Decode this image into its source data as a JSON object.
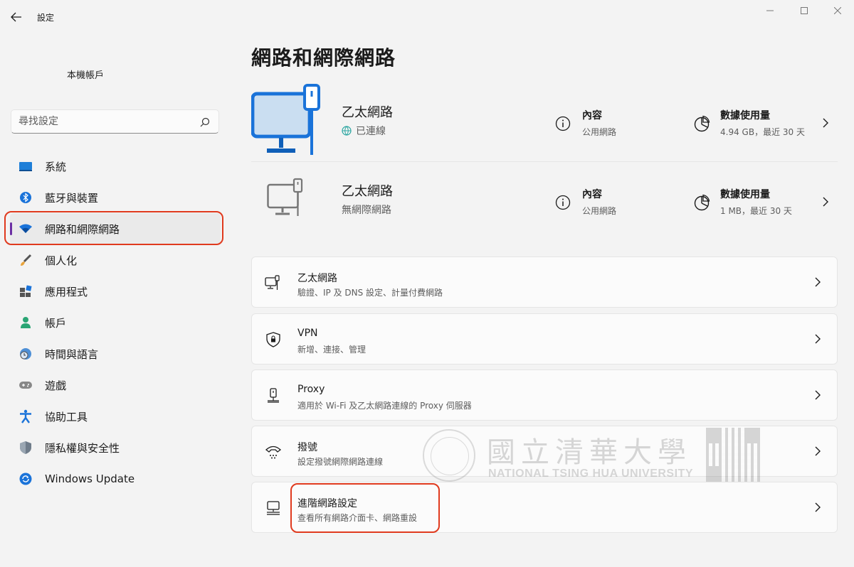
{
  "window": {
    "title": "設定"
  },
  "sidebar": {
    "account": "本機帳戶",
    "search_placeholder": "尋找設定",
    "items": [
      {
        "label": "系統",
        "icon": "system-icon"
      },
      {
        "label": "藍牙與裝置",
        "icon": "bluetooth-icon"
      },
      {
        "label": "網路和網際網路",
        "icon": "wifi-icon",
        "active": true
      },
      {
        "label": "個人化",
        "icon": "brush-icon"
      },
      {
        "label": "應用程式",
        "icon": "apps-icon"
      },
      {
        "label": "帳戶",
        "icon": "person-icon"
      },
      {
        "label": "時間與語言",
        "icon": "clock-globe-icon"
      },
      {
        "label": "遊戲",
        "icon": "gamepad-icon"
      },
      {
        "label": "協助工具",
        "icon": "accessibility-icon"
      },
      {
        "label": "隱私權與安全性",
        "icon": "shield-icon"
      },
      {
        "label": "Windows Update",
        "icon": "update-icon"
      }
    ]
  },
  "main": {
    "title": "網路和網際網路",
    "connections": [
      {
        "name": "乙太網路",
        "status": "已連線",
        "prop_title": "內容",
        "prop_sub": "公用網路",
        "data_title": "數據使用量",
        "data_sub": "4.94 GB，最近 30 天"
      },
      {
        "name": "乙太網路",
        "status": "無網際網路",
        "prop_title": "內容",
        "prop_sub": "公用網路",
        "data_title": "數據使用量",
        "data_sub": "1 MB，最近 30 天"
      }
    ],
    "cards": [
      {
        "title": "乙太網路",
        "sub": "驗證、IP 及 DNS 設定、計量付費網路",
        "icon": "ethernet-icon"
      },
      {
        "title": "VPN",
        "sub": "新增、連接、管理",
        "icon": "vpn-shield-icon"
      },
      {
        "title": "Proxy",
        "sub": "適用於 Wi-Fi 及乙太網路連線的 Proxy 伺服器",
        "icon": "proxy-icon"
      },
      {
        "title": "撥號",
        "sub": "設定撥號網際網路連線",
        "icon": "dialup-icon"
      },
      {
        "title": "進階網路設定",
        "sub": "查看所有網路介面卡、網路重設",
        "icon": "advanced-network-icon"
      }
    ]
  },
  "watermark": {
    "chinese": "國立清華大學",
    "english": "NATIONAL TSING HUA UNIVERSITY"
  },
  "colors": {
    "accent": "#0067c0",
    "active_bar": "#6b2fa3",
    "highlight": "#e03a1e"
  }
}
